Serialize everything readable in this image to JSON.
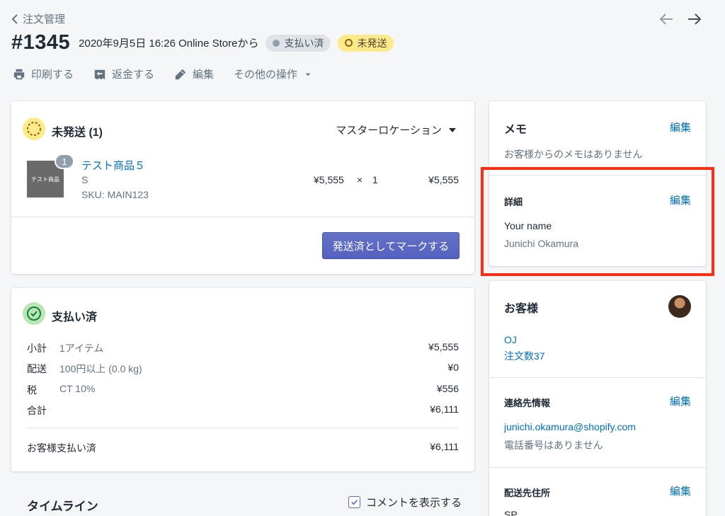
{
  "header": {
    "breadcrumb": "注文管理",
    "order_number": "#1345",
    "order_meta": "2020年9月5日 16:26 Online Storeから",
    "badges": {
      "paid": "支払い済",
      "unfulfilled": "未発送"
    },
    "actions": {
      "print": "印刷する",
      "refund": "返金する",
      "edit": "編集",
      "more": "その他の操作"
    }
  },
  "unfulfilled": {
    "title": "未発送 (1)",
    "location": "マスターロケーション",
    "item": {
      "thumb_text": "テスト商品",
      "quantity_badge": "1",
      "name": "テスト商品５",
      "variant": "S",
      "sku": "SKU: MAIN123",
      "unit_price": "¥5,555",
      "times": "×",
      "qty": "1",
      "total": "¥5,555"
    },
    "mark_button": "発送済としてマークする"
  },
  "paid": {
    "title": "支払い済",
    "rows": [
      {
        "label": "小計",
        "desc": "1アイテム",
        "value": "¥5,555"
      },
      {
        "label": "配送",
        "desc": "100円以上 (0.0 kg)",
        "value": "¥0"
      },
      {
        "label": "税",
        "desc": "CT 10%",
        "value": "¥556"
      },
      {
        "label": "合計",
        "desc": "",
        "value": "¥6,111"
      }
    ],
    "customer_paid_label": "お客様支払い済",
    "customer_paid_value": "¥6,111"
  },
  "timeline": {
    "title": "タイムライン",
    "show_comments": "コメントを表示する"
  },
  "memo": {
    "title": "メモ",
    "edit": "編集",
    "empty": "お客様からのメモはありません"
  },
  "details": {
    "title": "詳細",
    "edit": "編集",
    "field_label": "Your name",
    "field_value": "Junichi Okamura"
  },
  "customer": {
    "title": "お客様",
    "name": "OJ",
    "orders": "注文数37",
    "contact_title": "連絡先情報",
    "contact_edit": "編集",
    "email": "junichi.okamura@shopify.com",
    "phone": "電話番号はありません",
    "shipping_title": "配送先住所",
    "shipping_edit": "編集",
    "shipping_first_line": "SP"
  },
  "colors": {
    "accent": "#5c6ac4",
    "link": "#006fbb",
    "highlight": "#ff2e12"
  }
}
